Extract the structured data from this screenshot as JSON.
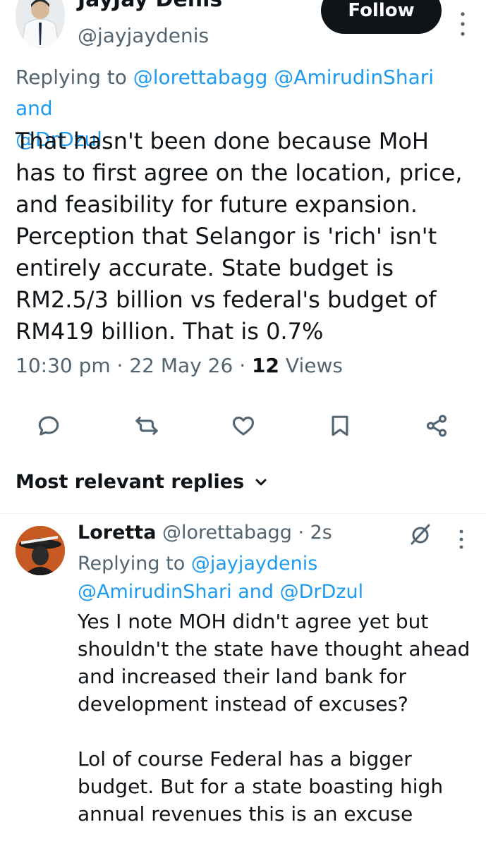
{
  "tweet": {
    "author_name": "JayJay Denis",
    "handle": "@jayjaydenis",
    "follow_label": "Follow",
    "reply_to_prefix": "Replying to",
    "reply_to_mentions_line1": "@lorettabagg @AmirudinShari and",
    "reply_to_mentions_line2": "@DrDzul",
    "text": "That hasn't been done because MoH\nhas to first agree on the location, price,\nand feasibility for future expansion.\nPerception that Selangor is 'rich' isn't\nentirely accurate. State budget is\nRM2.5/3 billion vs federal's budget of\nRM419 billion. That is 0.7%",
    "time": "10:30 pm",
    "date": "22 May 26",
    "views_count": "12",
    "views_label": "Views"
  },
  "actions": [
    {
      "name": "reply-icon"
    },
    {
      "name": "retweet-icon"
    },
    {
      "name": "like-icon"
    },
    {
      "name": "bookmark-icon"
    },
    {
      "name": "share-icon"
    }
  ],
  "replies_section": {
    "sort_label": "Most relevant replies"
  },
  "reply": {
    "author_name": "Loretta",
    "handle": "@lorettabagg",
    "age": "2s",
    "reply_to_prefix": "Replying to",
    "reply_to_mention1": "@jayjaydenis",
    "reply_to_mentions_line2": "@AmirudinShari and @DrDzul",
    "text": "Yes I note MOH didn't agree yet but\nshouldn't the state have thought ahead\nand increased their land bank for\ndevelopment instead of excuses?\n\nLol of course Federal has a bigger\nbudget. But for a state boasting high\nannual revenues this is an excuse"
  },
  "colors": {
    "link": "#1d9bf0",
    "secondary": "#536471",
    "primary": "#0f1419"
  }
}
